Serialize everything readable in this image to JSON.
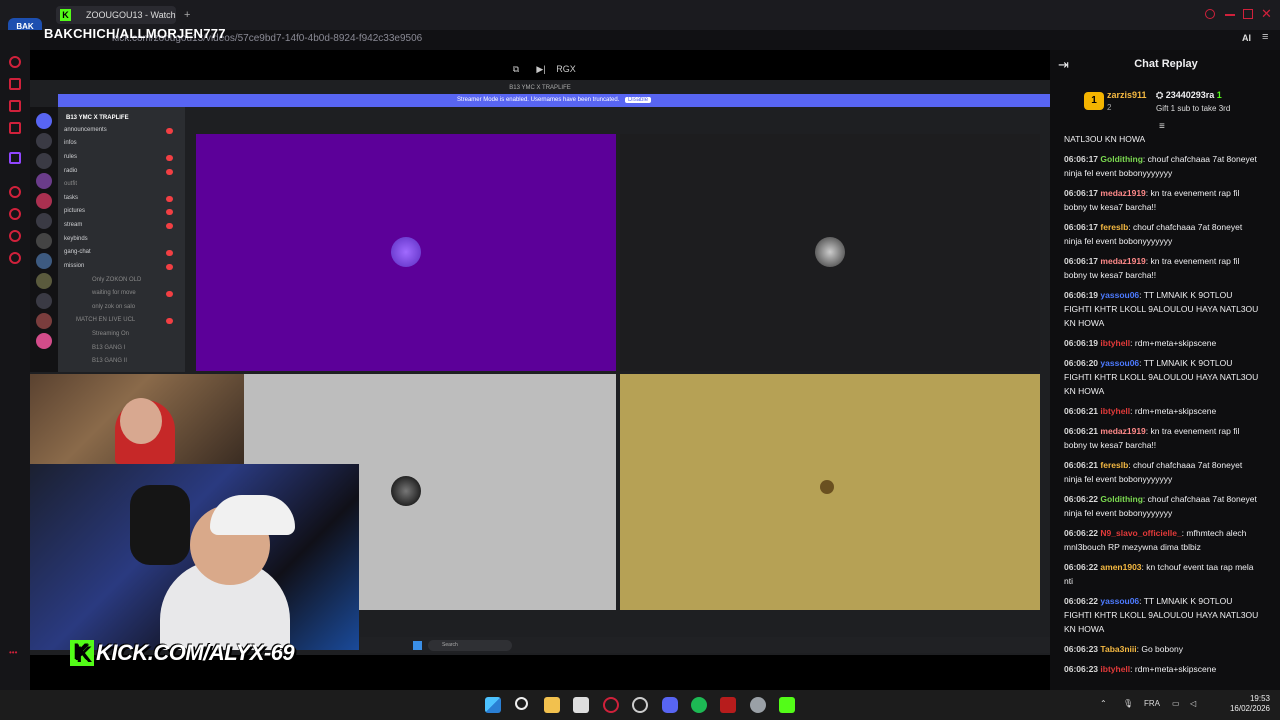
{
  "browser": {
    "tab_title": "ZOOUGOU13 - Watch",
    "url": "kick.com/zoougou13/videos/57ce9bd7-14f0-4b0d-8924-f942c33e9506",
    "toolbar_ai": "AI"
  },
  "overlay": {
    "channel_name": "BAKCHICH/ALLMORJEN777",
    "logo_text": "BAK CHICH",
    "kick_tag": "KICK.COM/ALYX-69",
    "kick_letter": "K"
  },
  "player": {
    "quality_label": "RGX"
  },
  "discord": {
    "window_title": "B13 YMC X TRAPLIFE",
    "banner": "Streamer Mode is enabled. Usernames have been truncated.",
    "banner_btn": "Disable",
    "server_name": "B13 YMC X TRAPLIFE",
    "channels": [
      "announcements",
      "infos",
      "rules",
      "radio",
      "outfit",
      "tasks",
      "pictures",
      "stream",
      "keybinds",
      "gang-chat",
      "mission",
      "Only ZOKON OLD",
      "waiting for move",
      "only zok on salo",
      "MATCH EN LIVE UCL",
      "Streaming On",
      "B13 GANG I",
      "B13 GANG II"
    ],
    "search_placeholder": "Search",
    "tile_colors": [
      "#5c0099",
      "#1d1d1f",
      "#bdbdbd",
      "#b6a155"
    ]
  },
  "chat": {
    "title": "Chat Replay",
    "gift_user": "zarzis911",
    "gift_rank": "1",
    "gift_count": "2",
    "gift_amount": "23440293ra",
    "gift_amount_sub": "1",
    "gift_text": "Gift 1 sub to take 3rd",
    "top_partial": "NATL3OU KN HOWA",
    "messages": [
      {
        "time": "06:06:17",
        "user": "Goldithing",
        "color": "#7bd850",
        "text": "chouf chafchaaa 7at 8oneyet ninja fel event bobonyyyyyyy"
      },
      {
        "time": "06:06:17",
        "user": "medaz1919",
        "color": "#ff8a8a",
        "text": "kn tra evenement rap fil bobny tw kesa7 barcha!!"
      },
      {
        "time": "06:06:17",
        "user": "fereslb",
        "color": "#f5b942",
        "text": "chouf chafchaaa 7at 8oneyet ninja fel event bobonyyyyyyy"
      },
      {
        "time": "06:06:17",
        "user": "medaz1919",
        "color": "#ff8a8a",
        "text": "kn tra evenement rap fil bobny tw kesa7 barcha!!"
      },
      {
        "time": "06:06:19",
        "user": "yassou06",
        "color": "#4d7bff",
        "text": "TT LMNAIK K 9OTLOU FIGHTI KHTR LKOLL 9ALOULOU HAYA NATL3OU KN HOWA"
      },
      {
        "time": "06:06:19",
        "user": "ibtyhell",
        "color": "#e23a3a",
        "text": "rdm+meta+skipscene"
      },
      {
        "time": "06:06:20",
        "user": "yassou06",
        "color": "#4d7bff",
        "text": "TT LMNAIK K 9OTLOU FIGHTI KHTR LKOLL 9ALOULOU HAYA NATL3OU KN HOWA"
      },
      {
        "time": "06:06:21",
        "user": "ibtyhell",
        "color": "#e23a3a",
        "text": "rdm+meta+skipscene"
      },
      {
        "time": "06:06:21",
        "user": "medaz1919",
        "color": "#ff8a8a",
        "text": "kn tra evenement rap fil bobny tw kesa7 barcha!!"
      },
      {
        "time": "06:06:21",
        "user": "fereslb",
        "color": "#f5b942",
        "text": "chouf chafchaaa 7at 8oneyet ninja fel event bobonyyyyyyy"
      },
      {
        "time": "06:06:22",
        "user": "Goldithing",
        "color": "#7bd850",
        "text": "chouf chafchaaa 7at 8oneyet ninja fel event bobonyyyyyyy"
      },
      {
        "time": "06:06:22",
        "user": "N9_slavo_officielle_",
        "color": "#e23a3a",
        "text": "mfhmtech alech mnl3bouch RP mezywna dima tblbiz"
      },
      {
        "time": "06:06:22",
        "user": "amen1903",
        "color": "#f5b942",
        "text": "kn tchouf event taa rap mela nti"
      },
      {
        "time": "06:06:22",
        "user": "yassou06",
        "color": "#4d7bff",
        "text": "TT LMNAIK K 9OTLOU FIGHTI KHTR LKOLL 9ALOULOU HAYA NATL3OU KN HOWA"
      },
      {
        "time": "06:06:23",
        "user": "Taba3niii",
        "color": "#f5b942",
        "text": "Go bobony"
      },
      {
        "time": "06:06:23",
        "user": "ibtyhell",
        "color": "#e23a3a",
        "text": "rdm+meta+skipscene"
      }
    ]
  },
  "taskbar": {
    "lang": "FRA",
    "time": "19:53",
    "date": "16/02/2026"
  }
}
